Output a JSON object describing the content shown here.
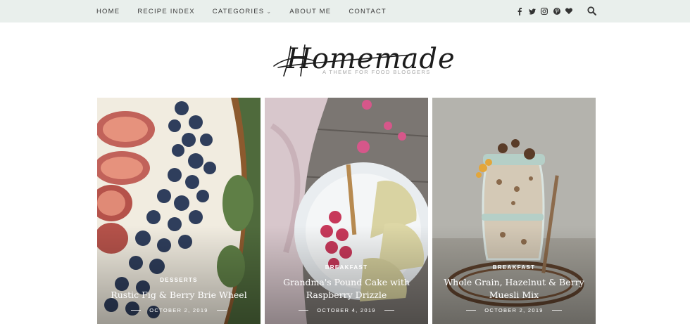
{
  "nav": {
    "items": [
      "HOME",
      "RECIPE INDEX",
      "CATEGORIES",
      "ABOUT ME",
      "CONTACT"
    ],
    "categories_chevron": "⌄"
  },
  "social": {
    "icons": [
      "facebook-icon",
      "twitter-icon",
      "instagram-icon",
      "pinterest-icon",
      "heart-icon"
    ]
  },
  "search": {
    "icon": "search-icon"
  },
  "logo": {
    "script": "Homemade",
    "tagline": "A THEME FOR FOOD BLOGGERS"
  },
  "cards": [
    {
      "category": "DESSERTS",
      "title": "Rustic Fig & Berry Brie Wheel",
      "date": "OCTOBER 2, 2019"
    },
    {
      "category": "BREAKFAST",
      "title": "Grandma's Pound Cake with Raspberry Drizzle",
      "date": "OCTOBER 4, 2019"
    },
    {
      "category": "BREAKFAST",
      "title": "Whole Grain, Hazelnut & Berry Muesli Mix",
      "date": "OCTOBER 2, 2019"
    }
  ],
  "colors": {
    "topbar": "#e9efec",
    "text": "#3a3a3a",
    "tagline": "#a7a7a7"
  }
}
